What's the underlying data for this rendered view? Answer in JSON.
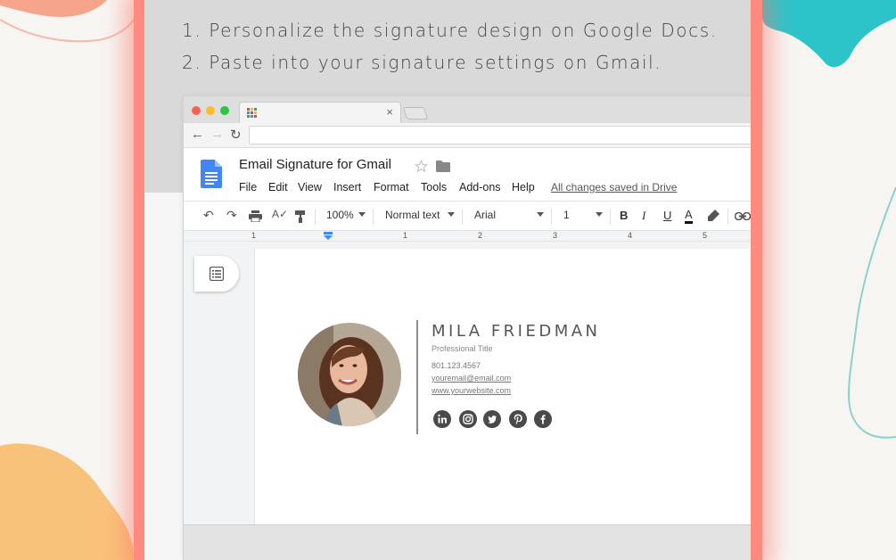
{
  "instructions": [
    "1. Personalize the signature design on Google Docs.",
    "2. Paste into your signature settings on Gmail."
  ],
  "browser": {
    "tab_close": "×",
    "nav": {
      "back": "←",
      "forward": "→",
      "reload": "↻"
    }
  },
  "docs": {
    "title": "Email Signature for Gmail",
    "menu": [
      "File",
      "Edit",
      "View",
      "Insert",
      "Format",
      "Tools",
      "Add-ons",
      "Help"
    ],
    "save_status": "All changes saved in Drive"
  },
  "toolbar": {
    "zoom": "100%",
    "style": "Normal text",
    "font": "Arial",
    "font_size": "1",
    "bold": "B",
    "italic": "I",
    "underline": "U",
    "text_color": "A"
  },
  "ruler": {
    "labels": [
      "1",
      "1",
      "2",
      "3",
      "4",
      "5"
    ]
  },
  "signature": {
    "name": "MILA FRIEDMAN",
    "title": "Professional Title",
    "phone": "801.123.4567",
    "email": "youremail@email.com",
    "website": "www.yourwebsite.com",
    "social": [
      "linkedin-icon",
      "instagram-icon",
      "twitter-icon",
      "pinterest-icon",
      "facebook-icon"
    ]
  },
  "colors": {
    "frame": "#ff8a80",
    "docs_blue": "#4285f4",
    "deco_orange": "#f9c27a",
    "deco_teal": "#2cc4c9",
    "deco_salmon": "#f7a48c"
  }
}
